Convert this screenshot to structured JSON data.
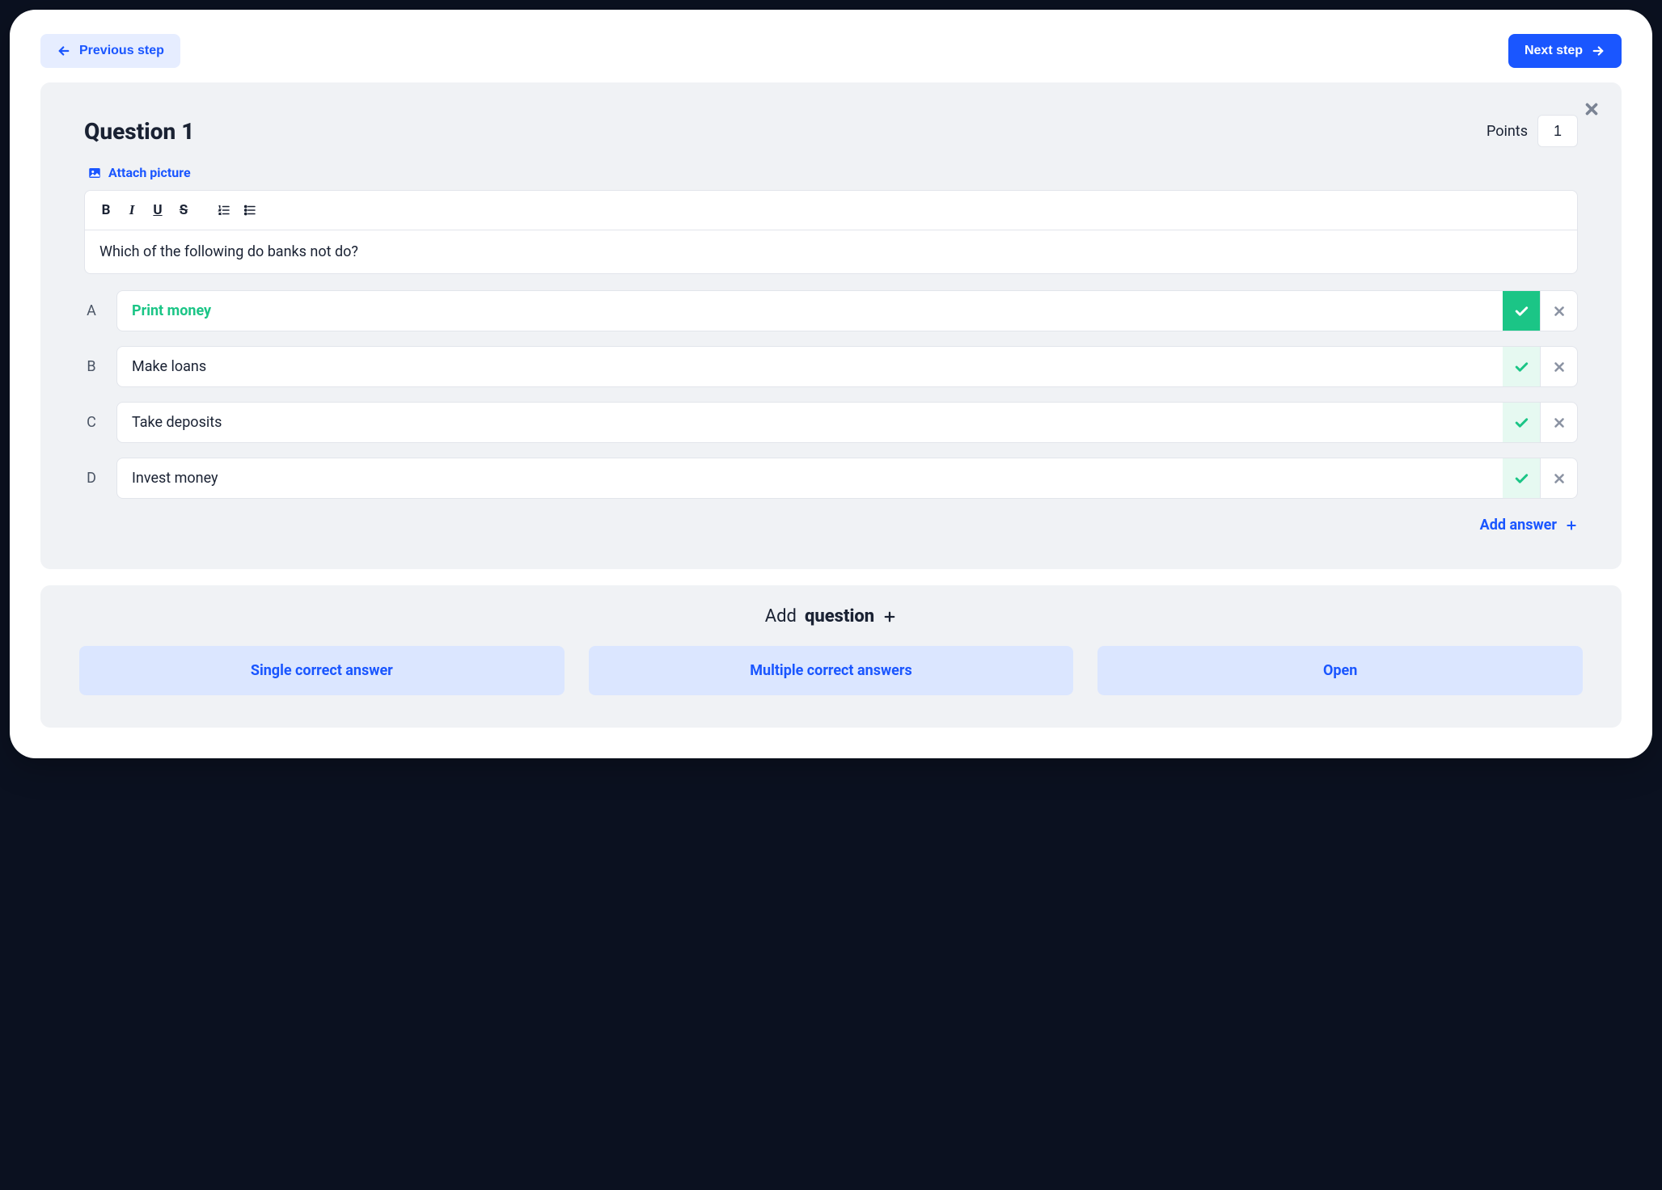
{
  "nav": {
    "prev_label": "Previous step",
    "next_label": "Next step"
  },
  "question": {
    "title": "Question 1",
    "points_label": "Points",
    "points_value": "1",
    "attach_label": "Attach picture",
    "text": "Which of the following do banks not do?",
    "answers": [
      {
        "letter": "A",
        "text": "Print money",
        "correct": true
      },
      {
        "letter": "B",
        "text": "Make loans",
        "correct": false
      },
      {
        "letter": "C",
        "text": "Take deposits",
        "correct": false
      },
      {
        "letter": "D",
        "text": "Invest money",
        "correct": false
      }
    ],
    "add_answer_label": "Add answer"
  },
  "add_question": {
    "prefix": "Add",
    "bold": "question",
    "types": {
      "single": "Single correct answer",
      "multiple": "Multiple correct answers",
      "open": "Open"
    }
  }
}
